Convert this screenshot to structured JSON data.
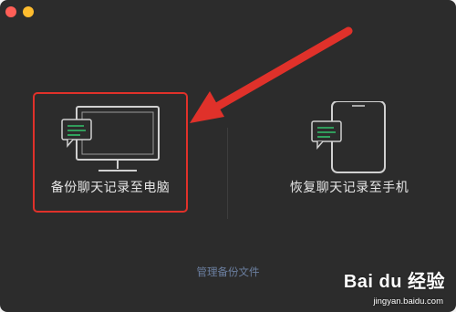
{
  "window": {
    "buttons": [
      "close",
      "minimize"
    ]
  },
  "options": {
    "backup": {
      "label": "备份聊天记录至电脑",
      "icon": "monitor-chat-icon",
      "highlighted": true
    },
    "restore": {
      "label": "恢复聊天记录至手机",
      "icon": "phone-chat-icon"
    }
  },
  "footer": {
    "manage_label": "管理备份文件"
  },
  "annotation": {
    "arrow_color": "#e0312a",
    "highlight_color": "#e0312a"
  },
  "watermark": {
    "brand": "Bai du 经验",
    "url": "jingyan.baidu.com"
  },
  "colors": {
    "background": "#2c2c2c",
    "text": "#e6e6e6",
    "link": "#6b7fa0",
    "chat_bubble": "#33c26b"
  }
}
